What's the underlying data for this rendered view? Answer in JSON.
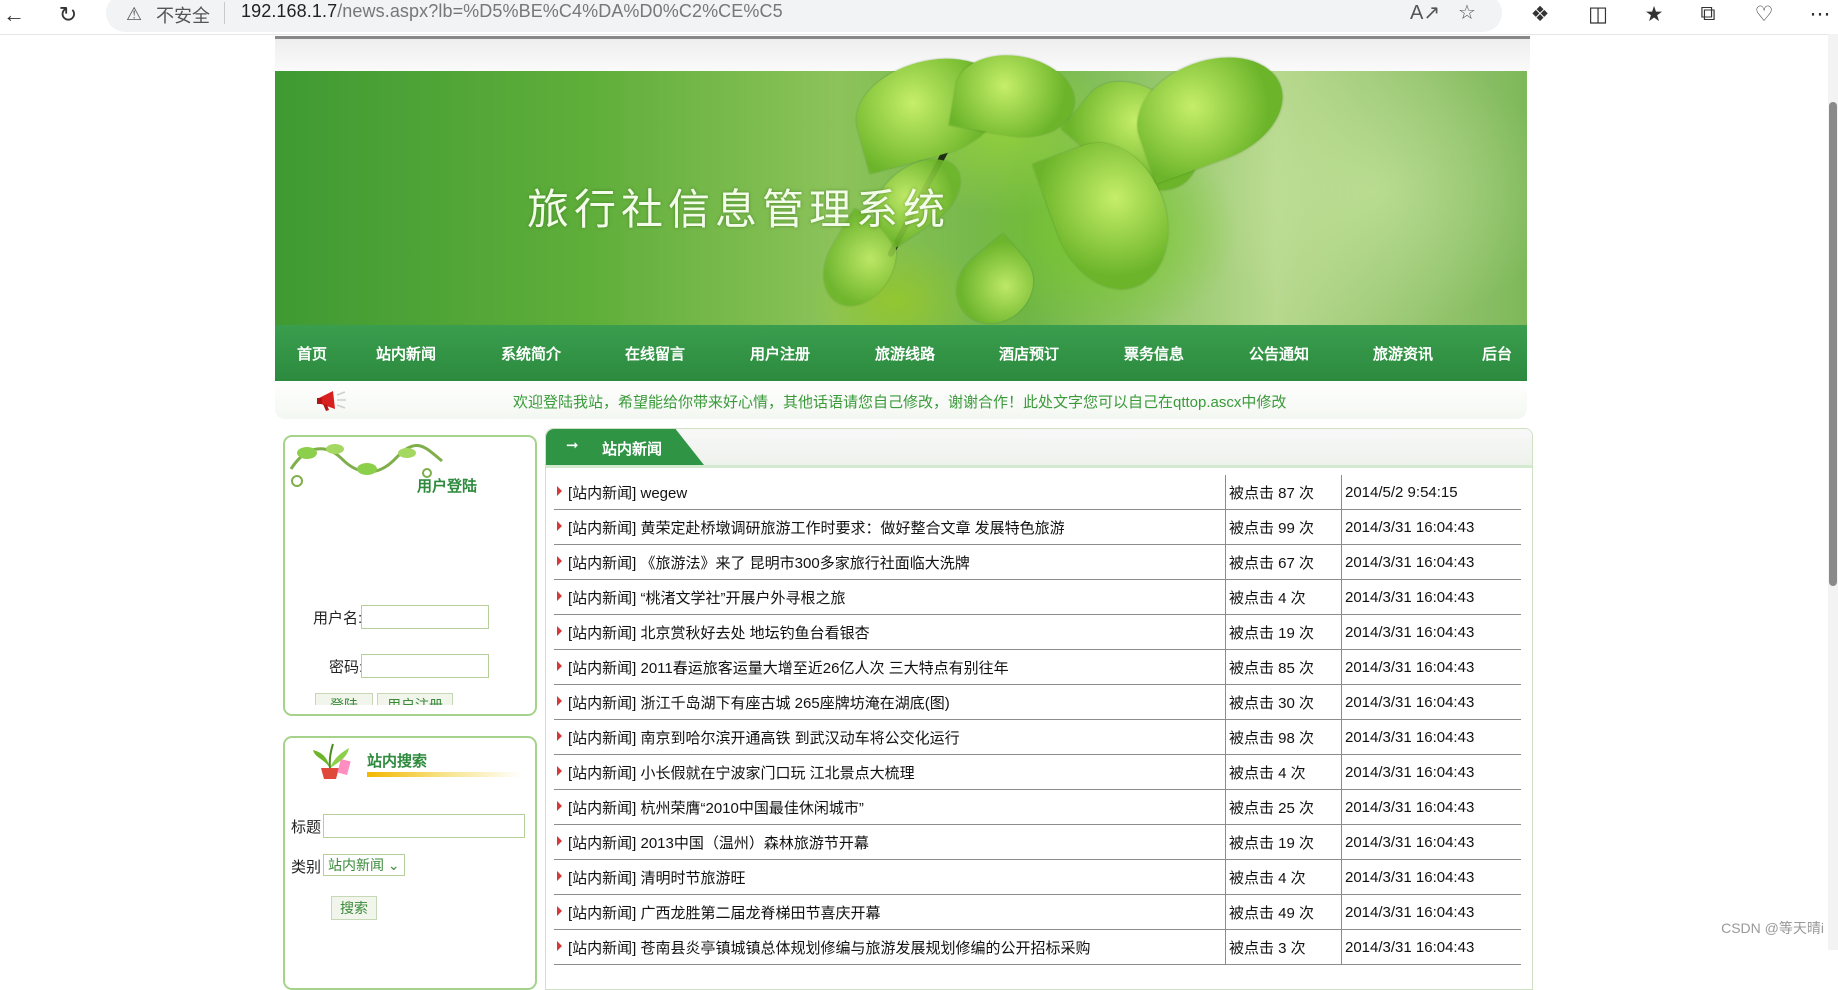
{
  "browser": {
    "security_label": "不安全",
    "url_host": "192.168.1.7",
    "url_path": "/news.aspx?lb=%D5%BE%C4%DA%D0%C2%CE%C5",
    "icons": [
      "back-arrow-icon",
      "refresh-icon",
      "warning-icon",
      "read-aloud-icon",
      "favorite-star-icon",
      "extensions-icon",
      "split-screen-icon",
      "favorites-list-icon",
      "collections-icon",
      "browser-essentials-icon",
      "more-icon"
    ]
  },
  "site": {
    "title": "旅行社信息管理系统",
    "menu": [
      "首页",
      "站内新闻",
      "系统简介",
      "在线留言",
      "用户注册",
      "旅游线路",
      "酒店预订",
      "票务信息",
      "公告通知",
      "旅游资讯",
      "后台"
    ],
    "notice": "欢迎登陆我站，希望能给你带来好心情，其他话语请您自己修改，谢谢合作！此处文字您可以自己在qttop.ascx中修改"
  },
  "login": {
    "title": "用户登陆",
    "username_label": "用户名:",
    "password_label": "密码:",
    "username_value": "",
    "password_value": "",
    "login_button": "登陆",
    "register_button": "用户注册"
  },
  "search": {
    "title": "站内搜索",
    "title_label": "标题",
    "title_value": "",
    "category_label": "类别",
    "category_value": "站内新闻",
    "search_button": "搜索"
  },
  "news": {
    "tab_label": "站内新闻",
    "rows": [
      {
        "title": "[站内新闻] wegew",
        "clicks": "被点击 87 次",
        "date": "2014/5/2 9:54:15"
      },
      {
        "title": "[站内新闻] 黄荣定赴桥墩调研旅游工作时要求：做好整合文章 发展特色旅游",
        "clicks": "被点击 99 次",
        "date": "2014/3/31 16:04:43"
      },
      {
        "title": "[站内新闻] 《旅游法》来了 昆明市300多家旅行社面临大洗牌",
        "clicks": "被点击 67 次",
        "date": "2014/3/31 16:04:43"
      },
      {
        "title": "[站内新闻] “桃渚文学社”开展户外寻根之旅",
        "clicks": "被点击 4 次",
        "date": "2014/3/31 16:04:43"
      },
      {
        "title": "[站内新闻] 北京赏秋好去处 地坛钓鱼台看银杏",
        "clicks": "被点击 19 次",
        "date": "2014/3/31 16:04:43"
      },
      {
        "title": "[站内新闻] 2011春运旅客运量大增至近26亿人次 三大特点有别往年",
        "clicks": "被点击 85 次",
        "date": "2014/3/31 16:04:43"
      },
      {
        "title": "[站内新闻] 浙江千岛湖下有座古城 265座牌坊淹在湖底(图)",
        "clicks": "被点击 30 次",
        "date": "2014/3/31 16:04:43"
      },
      {
        "title": "[站内新闻] 南京到哈尔滨开通高铁 到武汉动车将公交化运行",
        "clicks": "被点击 98 次",
        "date": "2014/3/31 16:04:43"
      },
      {
        "title": "[站内新闻] 小长假就在宁波家门口玩 江北景点大梳理",
        "clicks": "被点击 4 次",
        "date": "2014/3/31 16:04:43"
      },
      {
        "title": "[站内新闻] 杭州荣膺“2010中国最佳休闲城市”",
        "clicks": "被点击 25 次",
        "date": "2014/3/31 16:04:43"
      },
      {
        "title": "[站内新闻] 2013中国（温州）森林旅游节开幕",
        "clicks": "被点击 19 次",
        "date": "2014/3/31 16:04:43"
      },
      {
        "title": "[站内新闻] 清明时节旅游旺",
        "clicks": "被点击 4 次",
        "date": "2014/3/31 16:04:43"
      },
      {
        "title": "[站内新闻] 广西龙胜第二届龙脊梯田节喜庆开幕",
        "clicks": "被点击 49 次",
        "date": "2014/3/31 16:04:43"
      },
      {
        "title": "[站内新闻] 苍南县炎亭镇城镇总体规划修编与旅游发展规划修编的公开招标采购",
        "clicks": "被点击 3 次",
        "date": "2014/3/31 16:04:43"
      }
    ]
  },
  "watermark": "CSDN @等天晴i"
}
